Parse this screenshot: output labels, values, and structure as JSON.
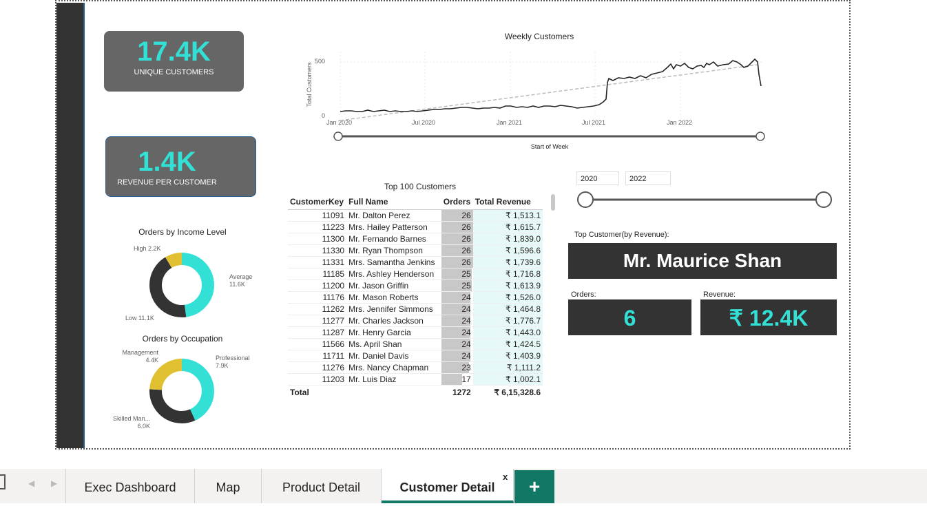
{
  "kpis": {
    "unique_customers": {
      "value": "17.4K",
      "label": "UNIQUE CUSTOMERS"
    },
    "revenue_per_customer": {
      "value": "1.4K",
      "label": "REVENUE PER CUSTOMER"
    }
  },
  "weekly_chart": {
    "title": "Weekly Customers",
    "ylabel": "Total Customers",
    "xlabel": "Start of Week",
    "y_ticks": [
      "0",
      "500"
    ],
    "x_ticks": [
      "Jan 2020",
      "Jul 2020",
      "Jan 2021",
      "Jul 2021",
      "Jan 2022"
    ]
  },
  "income_donut": {
    "title": "Orders by Income Level",
    "labels": [
      {
        "name": "High",
        "value": "2.2K"
      },
      {
        "name": "Average",
        "value": "11.6K"
      },
      {
        "name": "Low",
        "value": "11.1K"
      }
    ]
  },
  "occupation_donut": {
    "title": "Orders by Occupation",
    "labels": [
      {
        "name": "Management",
        "value": "4.4K"
      },
      {
        "name": "Professional",
        "value": "7.9K"
      },
      {
        "name": "Skilled Man...",
        "value": "6.0K"
      }
    ]
  },
  "table": {
    "title": "Top 100 Customers",
    "headers": [
      "CustomerKey",
      "Full Name",
      "Orders",
      "Total Revenue"
    ],
    "rows": [
      {
        "key": "11091",
        "name": "Mr. Dalton Perez",
        "orders": "26",
        "revenue": "₹ 1,513.1"
      },
      {
        "key": "11223",
        "name": "Mrs. Hailey Patterson",
        "orders": "26",
        "revenue": "₹ 1,615.7"
      },
      {
        "key": "11300",
        "name": "Mr. Fernando Barnes",
        "orders": "26",
        "revenue": "₹ 1,839.0"
      },
      {
        "key": "11330",
        "name": "Mr. Ryan Thompson",
        "orders": "26",
        "revenue": "₹ 1,596.6"
      },
      {
        "key": "11331",
        "name": "Mrs. Samantha Jenkins",
        "orders": "26",
        "revenue": "₹ 1,739.6"
      },
      {
        "key": "11185",
        "name": "Mrs. Ashley Henderson",
        "orders": "25",
        "revenue": "₹ 1,716.8"
      },
      {
        "key": "11200",
        "name": "Mr. Jason Griffin",
        "orders": "25",
        "revenue": "₹ 1,613.9"
      },
      {
        "key": "11176",
        "name": "Mr. Mason Roberts",
        "orders": "24",
        "revenue": "₹ 1,526.0"
      },
      {
        "key": "11262",
        "name": "Mrs. Jennifer Simmons",
        "orders": "24",
        "revenue": "₹ 1,464.8"
      },
      {
        "key": "11277",
        "name": "Mr. Charles Jackson",
        "orders": "24",
        "revenue": "₹ 1,776.7"
      },
      {
        "key": "11287",
        "name": "Mr. Henry Garcia",
        "orders": "24",
        "revenue": "₹ 1,443.0"
      },
      {
        "key": "11566",
        "name": "Ms. April Shan",
        "orders": "24",
        "revenue": "₹ 1,424.5"
      },
      {
        "key": "11711",
        "name": "Mr. Daniel Davis",
        "orders": "24",
        "revenue": "₹ 1,403.9"
      },
      {
        "key": "11276",
        "name": "Mrs. Nancy Chapman",
        "orders": "23",
        "revenue": "₹ 1,111.2"
      },
      {
        "key": "11203",
        "name": "Mr. Luis Diaz",
        "orders": "17",
        "revenue": "₹ 1,002.1"
      }
    ],
    "total": {
      "label": "Total",
      "orders": "1272",
      "revenue": "₹ 6,15,328.6"
    }
  },
  "year_slicer": {
    "from": "2020",
    "to": "2022"
  },
  "top_customer": {
    "label": "Top Customer(by Revenue):",
    "name": "Mr. Maurice Shan",
    "orders_label": "Orders:",
    "orders_value": "6",
    "revenue_label": "Revenue:",
    "revenue_value": "₹ 12.4K"
  },
  "tabs": {
    "items": [
      "Exec Dashboard",
      "Map",
      "Product Detail",
      "Customer Detail"
    ],
    "active": "Customer Detail",
    "close_glyph": "x",
    "add_glyph": "+"
  },
  "colors": {
    "accent": "#33e0d6",
    "yellow": "#e0c030",
    "dark": "#333333",
    "kpi_bg": "#666666",
    "tab_active": "#117865"
  }
}
